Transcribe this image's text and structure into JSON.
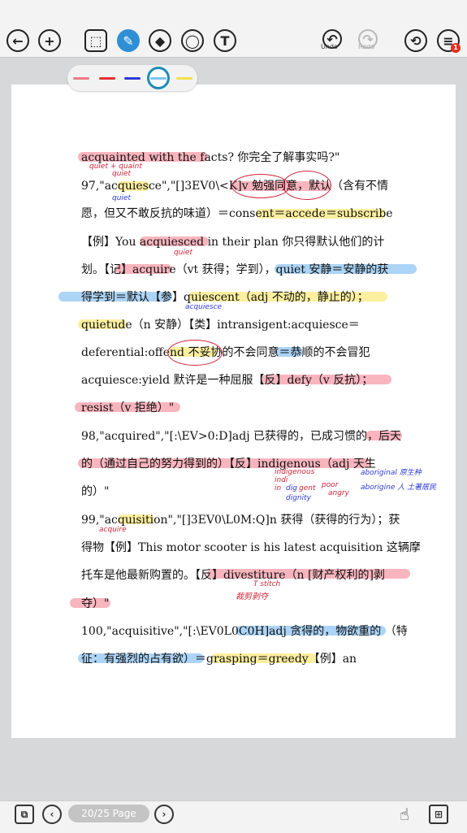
{
  "toolbar": {
    "back_icon": "←",
    "add_icon": "+",
    "select_icon": "⬚",
    "pen_icon": "✎",
    "eraser_icon": "◆",
    "lasso_icon": "◯",
    "text_icon": "T",
    "undo_icon": "↶",
    "undo_label": "Undo",
    "redo_icon": "↷",
    "redo_label": "Redo",
    "share_icon": "⟲",
    "menu_icon": "≡",
    "menu_badge": "1"
  },
  "palette": {
    "colors": [
      "#f07a86",
      "#e2302e",
      "#2d3bd6",
      "#7cc4f2",
      "#f4e04a"
    ],
    "selected": 3
  },
  "document": {
    "lines": [
      "acquainted with the facts?   你完全了解事实吗?\"",
      "97,\"acquiesce\",\"[]3EV0\\<K]v  勉强同意，默认（含有不情",
      "愿，但又不敢反抗的味道）＝consent＝accede＝subscribe",
      "【例】You acquiesced in their plan    你只得默认他们的计",
      "划。【记】acquire（vt  获得；学到），quiet 安静＝安静的获",
      "得学到＝默认【参】quiescent（adj  不动的，静止的）；",
      "quietude（n  安静）【类】intransigent:acquiesce＝",
      "deferential:offend  不妥协的不会同意＝恭顺的不会冒犯",
      "acquiesce:yield     默许是一种屈服【反】defy（v  反抗）；",
      "resist（v  拒绝）\"",
      "98,\"acquired\",\"[:\\EV>0:D]adj  已获得的，已成习惯的，后天",
      "的（通过自己的努力得到的）【反】indigenous（adj  天生",
      "的）\"",
      "99,\"acquisition\",\"[]3EV0\\L0M:Q]n  获得（获得的行为）；获",
      "得物【例】This motor scooter is his latest acquisition    这辆摩",
      "托车是他最新购置的。【反】divestiture（n [财产权利的]剥",
      "夺）\"",
      "100,\"acquisitive\",\"[:\\EV0L0C0H]adj  贪得的，物欲重的  （特",
      "征：有强烈的占有欲）＝grasping＝greedy【例】an"
    ],
    "annotations": [
      "quiet + quaint",
      "quiet",
      "quiet",
      "quiet",
      "acquiesce",
      "acquire",
      "indigenous",
      "indi",
      "in",
      "dig",
      "gent",
      "poor",
      "angry",
      "dignity",
      "aboriginal 原生种",
      "aborigine 人 土著居民",
      "T stitch",
      "裁剪剥夺"
    ]
  },
  "bottom": {
    "pages_icon": "⧉",
    "prev_icon": "‹",
    "page_indicator": "20/25 Page",
    "next_icon": "›",
    "touch_icon": "☝",
    "fit_icon": "⊞"
  }
}
